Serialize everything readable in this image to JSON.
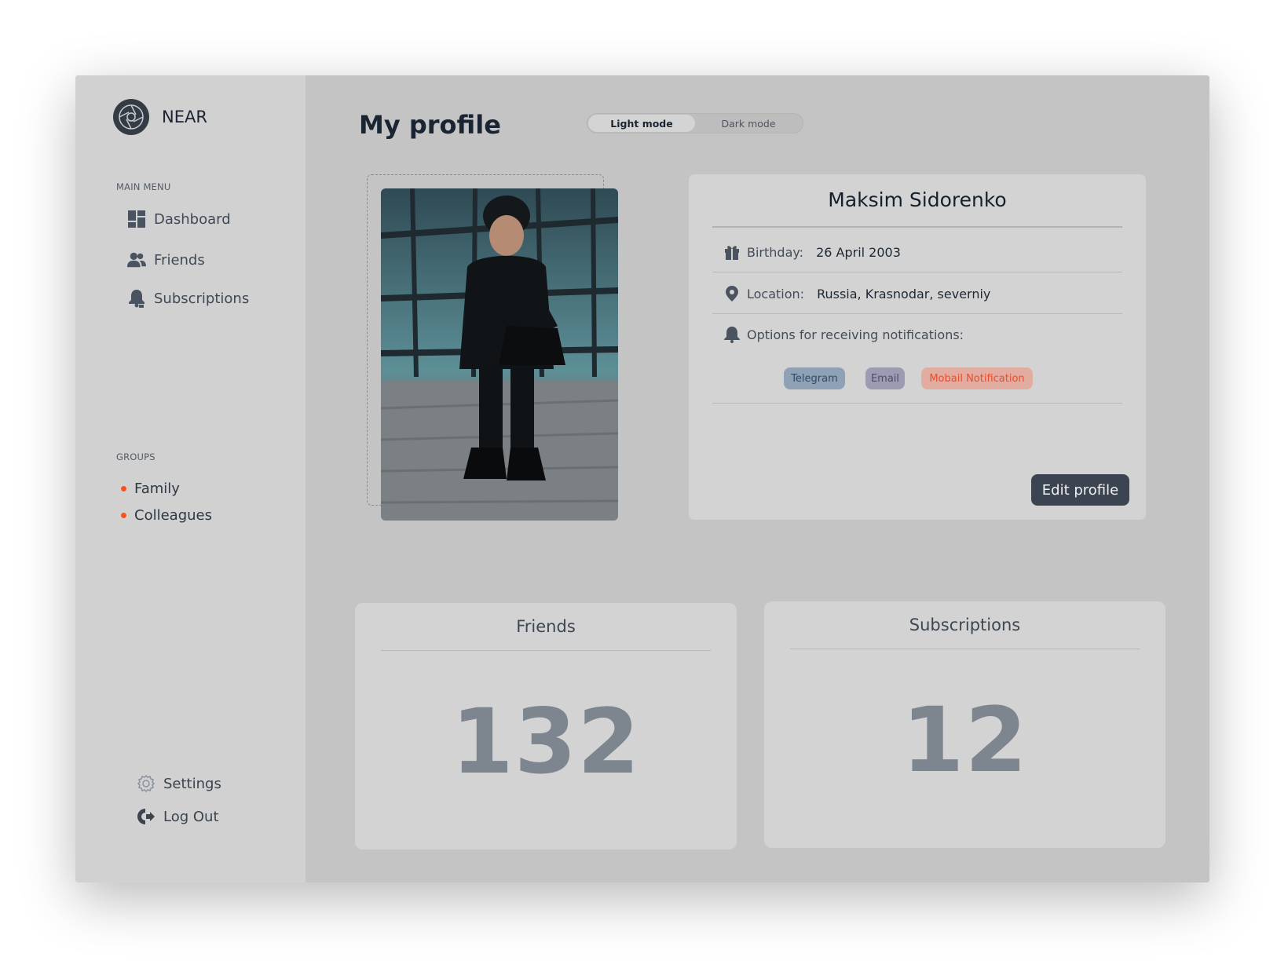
{
  "brand": {
    "name": "NEAR",
    "logo_icon": "aperture-icon"
  },
  "sidebar": {
    "main_menu_label": "MAIN MENU",
    "menu": [
      {
        "label": "Dashboard",
        "icon": "dashboard-icon"
      },
      {
        "label": "Friends",
        "icon": "users-icon"
      },
      {
        "label": "Subscriptions",
        "icon": "bell-user-icon"
      }
    ],
    "groups_label": "GROUPS",
    "groups": [
      {
        "label": "Family",
        "dot_color": "#ff4e1f"
      },
      {
        "label": "Colleagues",
        "dot_color": "#ff4e1f"
      }
    ],
    "settings_label": "Settings",
    "logout_label": "Log Out"
  },
  "header": {
    "title": "My profile",
    "mode_toggle": {
      "light": "Light mode",
      "dark": "Dark mode",
      "selected": "Light mode"
    }
  },
  "profile": {
    "name": "Maksim Sidorenko",
    "birthday_label": "Birthday:",
    "birthday_value": "26 April 2003",
    "location_label": "Location:",
    "location_value": "Russia, Krasnodar, severniy",
    "notifications_label": "Options for receiving notifications:",
    "notification_tags": [
      {
        "label": "Telegram",
        "bg": "#8fa1b5",
        "fg": "#2f4a66"
      },
      {
        "label": "Email",
        "bg": "#9c9bb1",
        "fg": "#4c4d6d"
      },
      {
        "label": "Mobail Notification",
        "bg": "#e3aca0",
        "fg": "#e84d2c"
      }
    ],
    "edit_button": "Edit profile"
  },
  "stats": {
    "friends_title": "Friends",
    "friends_count": "132",
    "subscriptions_title": "Subscriptions",
    "subscriptions_count": "12"
  },
  "colors": {
    "accent": "#ff4e1f",
    "button": "#3c4452",
    "sidebar_bg": "#d1d1d1",
    "main_bg": "#c4c4c4"
  }
}
